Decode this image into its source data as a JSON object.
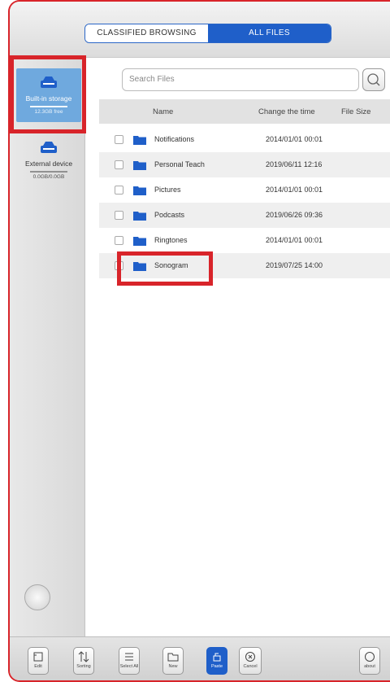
{
  "tabs": {
    "classified": "CLASSIFIED BROWSING",
    "all_files": "ALL FILES"
  },
  "sidebar": {
    "storages": [
      {
        "label": "Built-in storage",
        "capacity": "12.3GB free"
      },
      {
        "label": "External device",
        "capacity": "0.0GB/0.0GB"
      }
    ]
  },
  "search": {
    "placeholder": "Search Files"
  },
  "columns": {
    "name": "Name",
    "time": "Change the time",
    "size": "File Size"
  },
  "files": [
    {
      "name": "Notifications",
      "time": "2014/01/01 00:01"
    },
    {
      "name": "Personal Teach",
      "time": "2019/06/11 12:16"
    },
    {
      "name": "Pictures",
      "time": "2014/01/01 00:01"
    },
    {
      "name": "Podcasts",
      "time": "2019/06/26 09:36"
    },
    {
      "name": "Ringtones",
      "time": "2014/01/01 00:01"
    },
    {
      "name": "Sonogram",
      "time": "2019/07/25 14:00"
    }
  ],
  "toolbar": {
    "edit": "Edit",
    "sorting": "Sorting",
    "select_all": "Select All",
    "new": "New",
    "paste": "Paste",
    "cancel": "Cancel",
    "about": "about"
  },
  "colors": {
    "accent": "#1f5fc9",
    "highlight": "#d8242a",
    "sidebar_selected": "#6fa9de"
  }
}
